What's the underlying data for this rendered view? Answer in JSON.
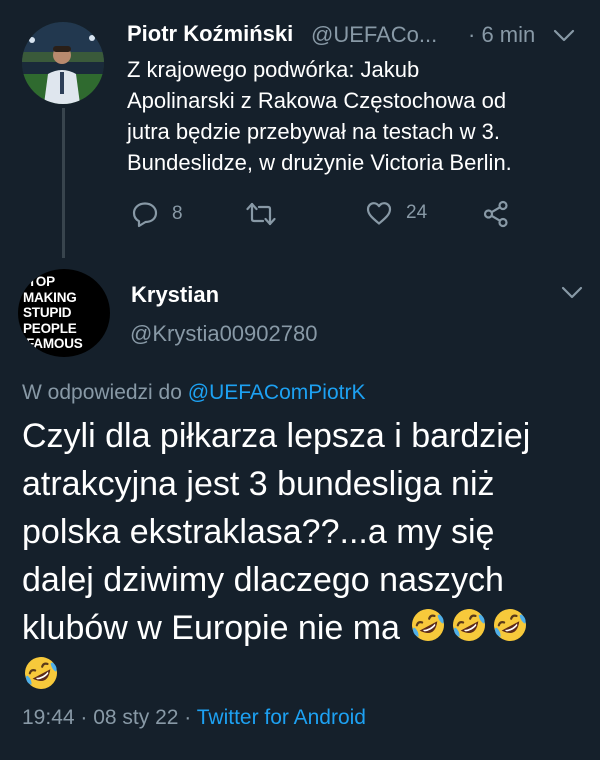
{
  "parent_tweet": {
    "author_name": "Piotr Koźmiński",
    "author_handle": "@UEFACo...",
    "time_ago": "· 6 min",
    "text_lines": [
      "Z krajowego podwórka: Jakub",
      "Apolinarski z Rakowa Częstochowa od",
      "jutra będzie przebywał na testach w 3.",
      "Bundeslidze, w drużynie Victoria Berlin."
    ],
    "reply_count": "8",
    "like_count": "24"
  },
  "main_tweet": {
    "author_name": "Krystian",
    "author_handle": "@Krystia00902780",
    "avatar_text_lines": [
      "TOP",
      "MAKING",
      "STUPID",
      "PEOPLE",
      "FAMOUS"
    ],
    "replying_prefix": "W odpowiedzi do",
    "replying_mention": "@UEFAComPiotrK",
    "text_lines": [
      "Czyli dla piłkarza lepsza i bardziej",
      "atrakcyjna jest 3 bundesliga niż",
      "polska ekstraklasa??...a my się",
      "dalej dziwimy dlaczego naszych",
      "klubów w Europie nie ma"
    ],
    "emoji": "rolling-on-the-floor-laughing",
    "timestamp": "19:44 · 08 sty 22 ·",
    "client": "Twitter for Android"
  },
  "colors": {
    "background": "#15202b",
    "text": "#ffffff",
    "secondary": "#8899a6",
    "link": "#1da1f2",
    "thread_line": "#38444d"
  }
}
